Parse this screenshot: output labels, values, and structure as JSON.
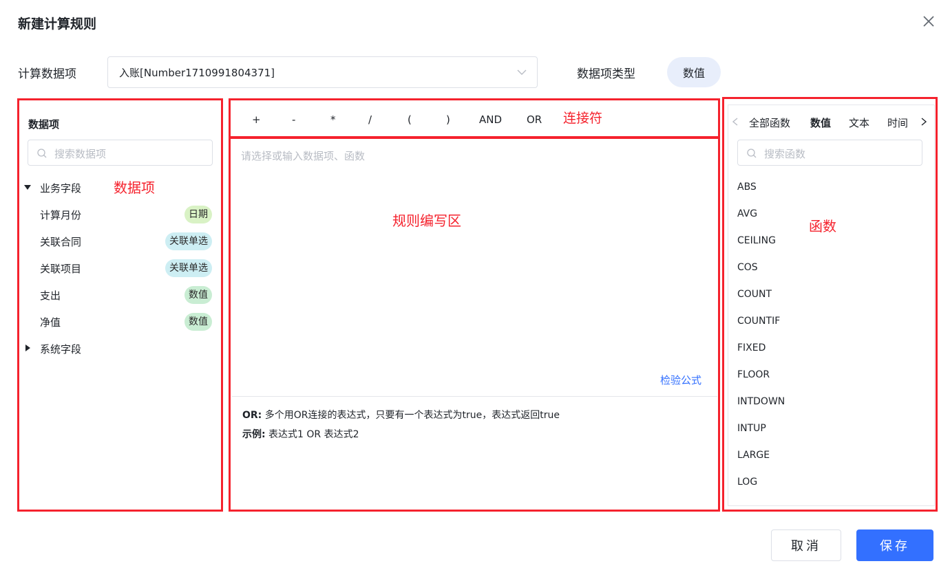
{
  "dialog": {
    "title": "新建计算规则"
  },
  "form": {
    "calc_item_label": "计算数据项",
    "calc_item_value": "入账[Number1710991804371]",
    "type_label": "数据项类型",
    "type_value": "数值"
  },
  "annotations": {
    "data_items": "数据项",
    "connectors": "连接符",
    "editor": "规则编写区",
    "functions": "函数"
  },
  "left_panel": {
    "title": "数据项",
    "search_placeholder": "搜索数据项",
    "groups": [
      {
        "label": "业务字段",
        "expanded": true
      },
      {
        "label": "系统字段",
        "expanded": false
      }
    ],
    "items": [
      {
        "label": "计算月份",
        "tag": "日期"
      },
      {
        "label": "关联合同",
        "tag": "关联单选"
      },
      {
        "label": "关联项目",
        "tag": "关联单选"
      },
      {
        "label": "支出",
        "tag": "数值"
      },
      {
        "label": "净值",
        "tag": "数值"
      }
    ]
  },
  "operators": [
    "+",
    "-",
    "*",
    "/",
    "(",
    ")",
    "AND",
    "OR"
  ],
  "editor": {
    "placeholder": "请选择或输入数据项、函数",
    "check_label": "检验公式",
    "desc_key": "OR:",
    "desc_text": " 多个用OR连接的表达式，只要有一个表达式为true，表达式返回true",
    "example_key": "示例:",
    "example_text": " 表达式1 OR 表达式2"
  },
  "right_panel": {
    "tabs": [
      "全部函数",
      "数值",
      "文本",
      "时间"
    ],
    "active_tab": "数值",
    "search_placeholder": "搜索函数",
    "functions": [
      "ABS",
      "AVG",
      "CEILING",
      "COS",
      "COUNT",
      "COUNTIF",
      "FIXED",
      "FLOOR",
      "INTDOWN",
      "INTUP",
      "LARGE",
      "LOG"
    ]
  },
  "footer": {
    "cancel_label": "取消",
    "save_label": "保存"
  },
  "colors": {
    "accent": "#3370ff",
    "annotation": "#f5222d"
  }
}
